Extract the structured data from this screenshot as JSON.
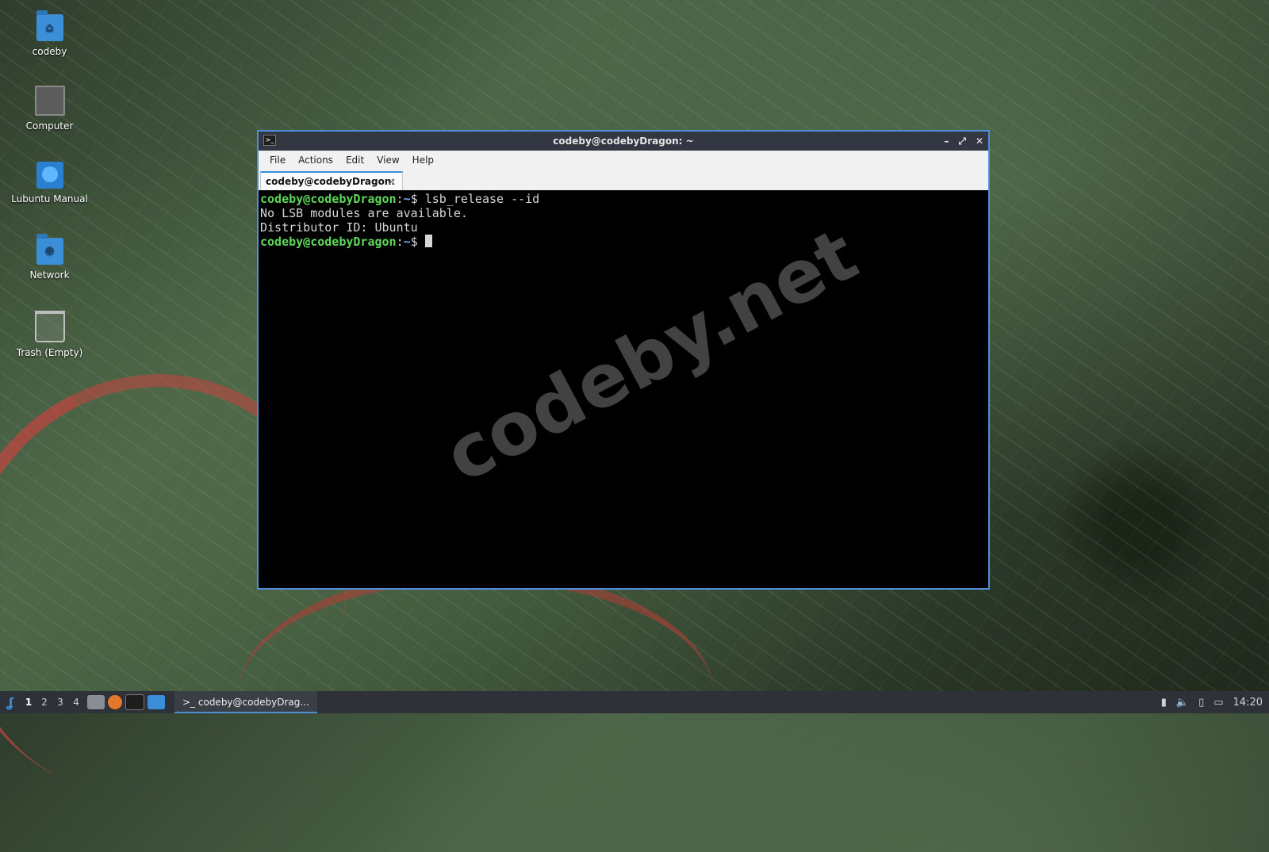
{
  "desktop": {
    "icons": [
      {
        "label": "codeby",
        "icon": "home-folder-icon"
      },
      {
        "label": "Computer",
        "icon": "computer-icon"
      },
      {
        "label": "Lubuntu Manual",
        "icon": "manual-icon"
      },
      {
        "label": "Network",
        "icon": "network-folder-icon"
      },
      {
        "label": "Trash (Empty)",
        "icon": "trash-icon"
      }
    ]
  },
  "window": {
    "title": "codeby@codebyDragon: ~",
    "menu": [
      "File",
      "Actions",
      "Edit",
      "View",
      "Help"
    ],
    "tab_label": "codeby@codebyDragon: ~",
    "tab_close": "×"
  },
  "terminal": {
    "lines": [
      {
        "user": "codeby@codebyDragon",
        "sep": ":",
        "path": "~",
        "prompt": "$ ",
        "cmd": "lsb_release --id"
      },
      {
        "text": "No LSB modules are available."
      },
      {
        "text": "Distributor ID: Ubuntu"
      },
      {
        "user": "codeby@codebyDragon",
        "sep": ":",
        "path": "~",
        "prompt": "$ ",
        "cmd": ""
      }
    ],
    "watermark": "codeby.net"
  },
  "taskbar": {
    "workspaces": [
      "1",
      "2",
      "3",
      "4"
    ],
    "active_task": "codeby@codebyDrag...",
    "clock": "14:20"
  },
  "colors": {
    "accent": "#4f8fd8",
    "prompt_user": "#5ed85a",
    "prompt_path": "#6fa8ff"
  }
}
